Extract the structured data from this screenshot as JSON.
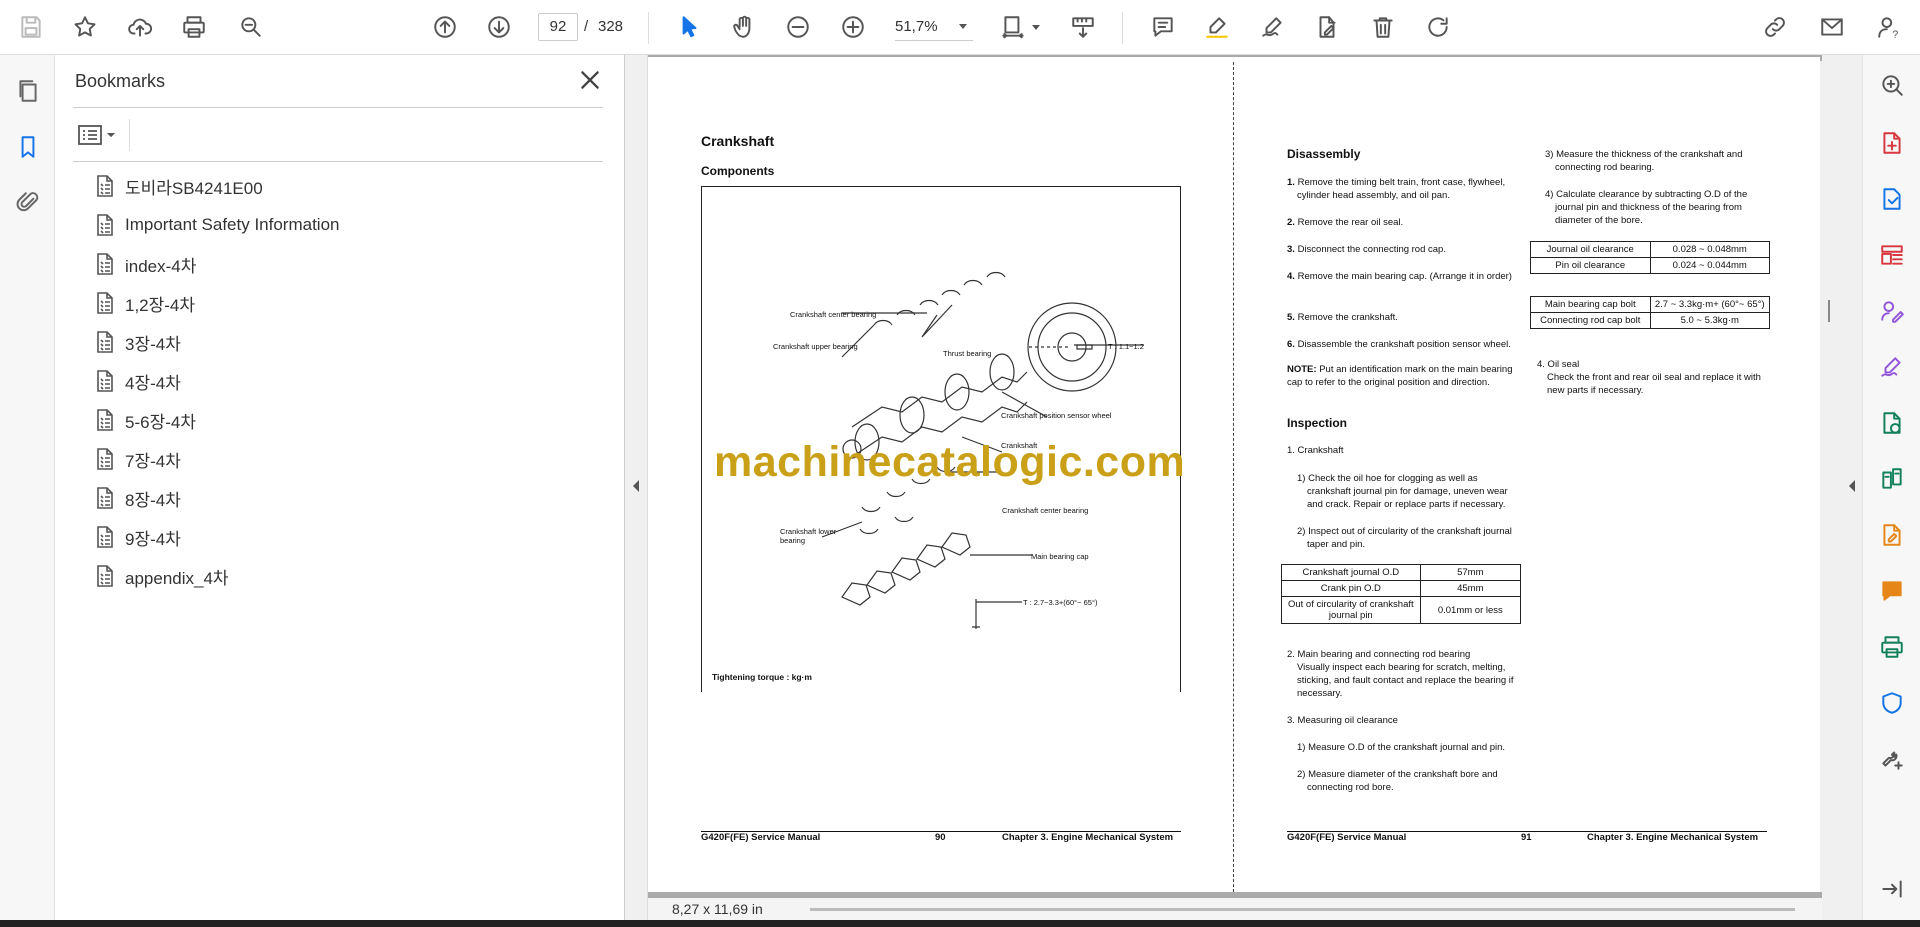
{
  "toolbar": {
    "page_current": "92",
    "page_sep": "/",
    "page_total": "328",
    "zoom": "51,7%"
  },
  "bookmarks": {
    "title": "Bookmarks",
    "items": [
      {
        "label": "도비라SB4241E00"
      },
      {
        "label": "Important Safety Information"
      },
      {
        "label": "index-4차"
      },
      {
        "label": "1,2장-4차"
      },
      {
        "label": "3장-4차"
      },
      {
        "label": "4장-4차"
      },
      {
        "label": "5-6장-4차"
      },
      {
        "label": "7장-4차"
      },
      {
        "label": "8장-4차"
      },
      {
        "label": "9장-4차"
      },
      {
        "label": "appendix_4차"
      }
    ]
  },
  "status": {
    "page_size": "8,27 x 11,69 in"
  },
  "watermark": "machinecatalogic.com",
  "left_page": {
    "title": "Crankshaft",
    "subtitle": "Components",
    "labels": {
      "center_bearing_top": "Crankshaft center bearing",
      "upper_bearing": "Crankshaft upper bearing",
      "thrust": "Thrust bearing",
      "torque1": "T : 1.1~1.2",
      "sensor_wheel": "Crankshaft position sensor wheel",
      "crankshaft": "Crankshaft",
      "center_bearing_mid": "Crankshaft center bearing",
      "lower_bearing": "Crankshaft lower bearing",
      "main_cap": "Main bearing cap",
      "torque2": "T : 2.7~3.3+(60°~ 65°)",
      "torque_note": "Tightening torque : kg·m"
    },
    "footer": {
      "manual": "G420F(FE) Service Manual",
      "page": "90",
      "chapter": "Chapter 3. Engine Mechanical System"
    }
  },
  "right_page": {
    "disassembly_title": "Disassembly",
    "steps": [
      {
        "n": "1.",
        "text": "Remove the timing belt train, front case, flywheel, cylinder head assembly, and oil pan."
      },
      {
        "n": "2.",
        "text": "Remove the rear oil seal."
      },
      {
        "n": "3.",
        "text": "Disconnect the connecting rod cap."
      },
      {
        "n": "4.",
        "text": "Remove the main bearing cap. (Arrange it in order)"
      },
      {
        "n": "5.",
        "text": "Remove the crankshaft."
      },
      {
        "n": "6.",
        "text": "Disassemble the crankshaft position sensor wheel."
      }
    ],
    "note_label": "NOTE:",
    "note_text": "Put an identification mark on the main bearing cap to refer to the original position and direction.",
    "inspection_title": "Inspection",
    "insp1": "1. Crankshaft",
    "insp1_a": "1) Check the oil hoe for clogging as well as crankshaft journal pin for damage, uneven wear and crack. Repair or replace parts if necessary.",
    "insp1_b": "2) Inspect out of circularity of the crankshaft journal taper and pin.",
    "table1": [
      [
        "Crankshaft journal O.D",
        "57mm"
      ],
      [
        "Crank pin O.D",
        "45mm"
      ],
      [
        "Out of circularity of crankshaft journal pin",
        "0.01mm or less"
      ]
    ],
    "insp2_head": "2. Main bearing and connecting rod bearing",
    "insp2_text": "Visually inspect each bearing for scratch, melting, sticking, and fault contact and replace the bearing if necessary.",
    "insp3": "3. Measuring oil clearance",
    "insp3_a": "1) Measure O.D of the crankshaft journal and pin.",
    "insp3_b": "2) Measure diameter of the crankshaft bore and connecting rod bore.",
    "col2_3": "3) Measure the thickness of the crankshaft and connecting rod bearing.",
    "col2_4": "4) Calculate clearance by subtracting O.D of the journal pin and thickness of the bearing from diameter of the bore.",
    "table2": [
      [
        "Journal oil clearance",
        "0.028 ~ 0.048mm"
      ],
      [
        "Pin oil clearance",
        "0.024 ~ 0.044mm"
      ]
    ],
    "table3": [
      [
        "Main bearing cap bolt",
        "2.7 ~ 3.3kg·m+ (60°~ 65°)"
      ],
      [
        "Connecting rod cap bolt",
        "5.0 ~ 5.3kg·m"
      ]
    ],
    "oilseal_head": "4. Oil seal",
    "oilseal_text": "Check the front and rear oil seal and replace it with new parts if necessary.",
    "footer": {
      "manual": "G420F(FE) Service Manual",
      "page": "91",
      "chapter": "Chapter 3. Engine Mechanical System"
    }
  }
}
